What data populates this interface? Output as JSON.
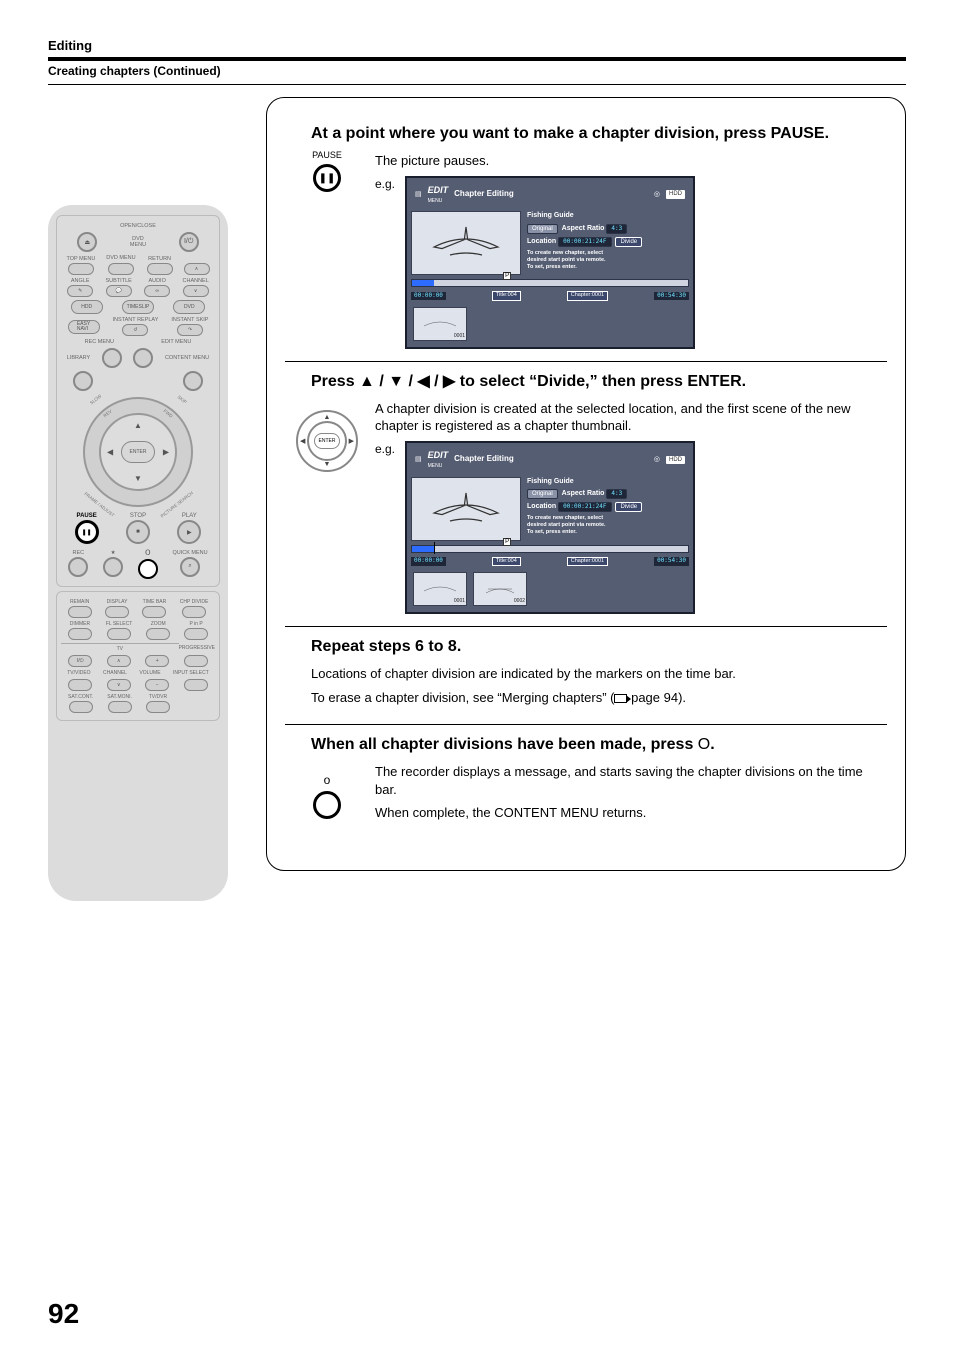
{
  "header": {
    "section": "Editing",
    "subsection": "Creating chapters (Continued)"
  },
  "remote": {
    "labels": {
      "open_close": "OPEN/CLOSE",
      "dvd_menu": "DVD\nMENU",
      "top_menu": "TOP MENU",
      "return": "RETURN",
      "angle": "ANGLE",
      "subtitle": "SUBTITLE",
      "audio": "AUDIO",
      "channel": "CHANNEL",
      "hdd": "HDD",
      "timeslip": "TIMESLIP",
      "dvd": "DVD",
      "easy_navi": "EASY\nNAVI",
      "instant_replay": "INSTANT REPLAY",
      "instant_skip": "INSTANT SKIP",
      "rec_menu": "REC MENU",
      "edit_menu": "EDIT MENU",
      "library": "LIBRARY",
      "content_menu": "CONTENT MENU",
      "enter": "ENTER",
      "slow": "SLOW",
      "rev": "REV",
      "skip": "SKIP",
      "fwd": "FWD",
      "frame_adjust": "FRAME /  ADJUST",
      "picture_search": "PICTURE SEARCH",
      "pause": "PAUSE",
      "stop": "STOP",
      "play": "PLAY",
      "rec": "REC",
      "quick_menu": "QUICK MENU",
      "remain": "REMAIN",
      "display": "DISPLAY",
      "time_bar": "TIME BAR",
      "chp_divide": "CHP DIVIDE",
      "dimmer": "DIMMER",
      "fl_select": "FL SELECT",
      "zoom": "ZOOM",
      "p_in_p": "P in P",
      "tv": "TV",
      "progressive": "PROGRESSIVE",
      "tv_video": "TV/VIDEO",
      "channel2": "CHANNEL",
      "volume": "VOLUME",
      "input_select": "INPUT SELECT",
      "sat_cont": "SAT.CONT.",
      "sat_moni": "SAT.MONI.",
      "tv_dvr": "TV/DVR"
    }
  },
  "steps": {
    "step6": {
      "heading": "At a point where you want to make a chapter division,  press PAUSE.",
      "side_label": "PAUSE",
      "body": "The picture pauses.",
      "eg": "e.g."
    },
    "step7": {
      "heading": "Press ▲ / ▼ / ◀ / ▶ to select “Divide,” then press ENTER.",
      "body": "A chapter division is created at the selected location, and the first scene of the new chapter is registered as a chapter thumbnail.",
      "eg": "e.g."
    },
    "step8": {
      "heading": "Repeat steps 6 to 8.",
      "body1": "Locations of chapter division are indicated by the markers on the time bar.",
      "body2_pre": "To erase a chapter division, see “Merging chapters” (",
      "body2_post": " page 94)."
    },
    "step9": {
      "heading_pre": "When all chapter divisions have been made, press ",
      "heading_post": ".",
      "body1": "The recorder displays a message, and starts saving the chapter divisions on the time bar.",
      "body2": "When complete, the CONTENT MENU returns."
    }
  },
  "osd": {
    "logo": "EDIT",
    "logo_sub": "MENU",
    "title": "Chapter Editing",
    "hdd": "HDD",
    "content_title": "Fishing Guide",
    "original": "Original",
    "aspect_label": "Aspect Ratio",
    "aspect_value": "4:3",
    "location_label": "Location",
    "location_value": "00:00:21:24F",
    "divide": "Divide",
    "hint1": "To create new chapter, select",
    "hint2": "desired start point via remote.",
    "hint3": "To set, press enter.",
    "time_start": "00:00:00",
    "title_badge": "Title:004",
    "chapter_badge": "Chapter:0001",
    "time_end": "00:54:30",
    "thumb1": "0001",
    "thumb2": "0002"
  },
  "page_number": "92"
}
